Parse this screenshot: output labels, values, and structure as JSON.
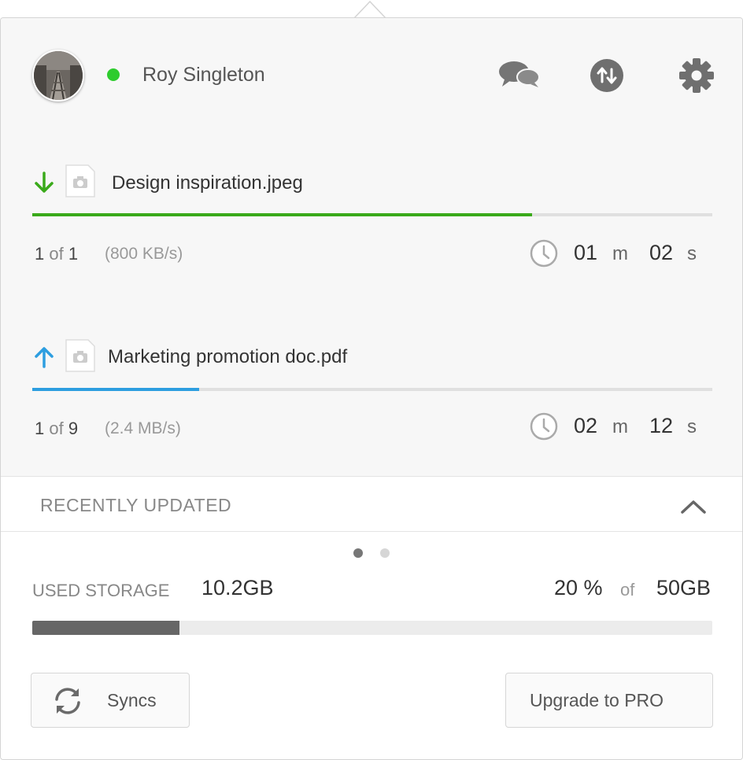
{
  "user": {
    "name": "Roy Singleton",
    "status_color": "#2ecc2e"
  },
  "header_icons": [
    "chat-icon",
    "transfer-icon",
    "gear-icon"
  ],
  "transfers": [
    {
      "direction": "download",
      "file_name": "Design inspiration.jpeg",
      "progress": 0.735,
      "color": "#3aaa1a",
      "current": "1",
      "of": "of",
      "total": "1",
      "speed": "(800 KB/s)",
      "minutes": "01",
      "m": "m",
      "seconds": "02",
      "s": "s"
    },
    {
      "direction": "upload",
      "file_name": "Marketing promotion doc.pdf",
      "progress": 0.245,
      "color": "#2d9ee0",
      "current": "1",
      "of": "of",
      "total": "9",
      "speed": "(2.4 MB/s)",
      "minutes": "02",
      "m": "m",
      "seconds": "12",
      "s": "s"
    }
  ],
  "recent": {
    "label": "RECENTLY UPDATED",
    "pages": 2,
    "active_page": 1
  },
  "storage": {
    "label": "USED STORAGE",
    "used": "10.2GB",
    "percent": "20 %",
    "of": "of",
    "total": "50GB",
    "fraction": 0.217
  },
  "buttons": {
    "syncs": "Syncs",
    "upgrade": "Upgrade to PRO"
  }
}
